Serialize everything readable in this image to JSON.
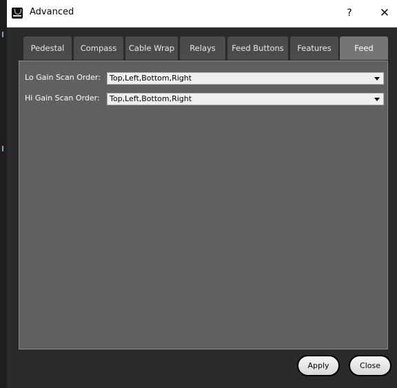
{
  "window": {
    "title": "Advanced",
    "help_label": "?",
    "close_label": "✕"
  },
  "tabs": [
    {
      "label": "Pedestal",
      "active": false
    },
    {
      "label": "Compass",
      "active": false
    },
    {
      "label": "Cable Wrap",
      "active": false
    },
    {
      "label": "Relays",
      "active": false
    },
    {
      "label": "Feed Buttons",
      "active": false
    },
    {
      "label": "Features",
      "active": false
    },
    {
      "label": "Feed",
      "active": true
    }
  ],
  "feed": {
    "lo_gain_label": "Lo Gain Scan Order:",
    "lo_gain_value": "Top,Left,Bottom,Right",
    "hi_gain_label": "Hi Gain Scan Order:",
    "hi_gain_value": "Top,Left,Bottom,Right"
  },
  "buttons": {
    "apply_label": "Apply",
    "close_label": "Close"
  },
  "colors": {
    "panel_bg": "#606060",
    "tab_bg": "#4b4b4b",
    "tab_active_bg": "#757575",
    "dialog_bg": "#2a2a2a"
  }
}
